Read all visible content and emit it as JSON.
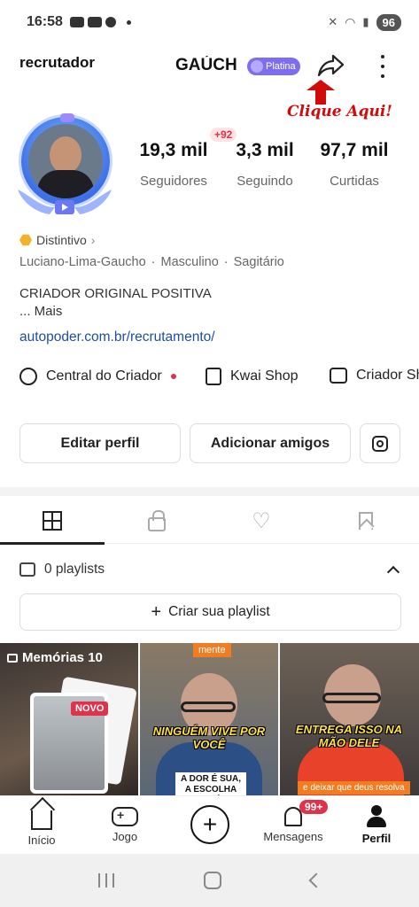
{
  "status_bar": {
    "time": "16:58",
    "battery": "96"
  },
  "header": {
    "username": "recrutador",
    "display_name": "GAÚCH",
    "badge": "Platina",
    "annotation": "Clique Aqui!"
  },
  "stats": {
    "followers_badge": "+92",
    "items": [
      {
        "value": "19,3 mil",
        "label": "Seguidores"
      },
      {
        "value": "3,3 mil",
        "label": "Seguindo"
      },
      {
        "value": "97,7 mil",
        "label": "Curtidas"
      }
    ]
  },
  "profile": {
    "distintivo": "Distintivo",
    "meta": [
      "Luciano-Lima-Gaucho",
      "Masculino",
      "Sagitário"
    ],
    "bio_line": "CRIADOR ORIGINAL POSITIVA",
    "bio_more": "...  Mais",
    "link": "autopoder.com.br/recrutamento/"
  },
  "quick_links": [
    "Central do Criador",
    "Kwai Shop",
    "Criador Sh"
  ],
  "buttons": {
    "edit": "Editar perfil",
    "add_friends": "Adicionar amigos"
  },
  "playlists": {
    "count_label": "0 playlists",
    "create_label": "Criar sua playlist"
  },
  "thumbs": {
    "memorias": "Memórias 10",
    "novo": "NOVO",
    "t2_tag": "mente",
    "t2_caption": "NINGUÉM VIVE POR VOCÊ",
    "t2_sub": "A DOR É SUA, A ESCOLHA TAMBÉM!",
    "t3_caption": "ENTREGA ISSO NA MÃO DELE",
    "t3_sub": "e deixar que deus resolva"
  },
  "bottom_nav": {
    "home": "Início",
    "game": "Jogo",
    "messages": "Mensagens",
    "messages_badge": "99+",
    "profile": "Perfil"
  },
  "colors": {
    "accent": "#e0324b",
    "badge": "#7e6cf2",
    "link": "#1f4f9c",
    "annotation": "#d10a0a"
  }
}
